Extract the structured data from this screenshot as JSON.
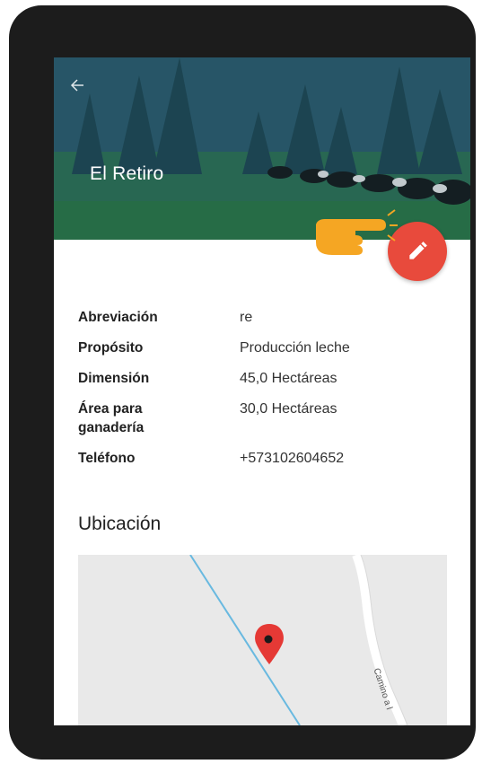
{
  "header": {
    "title": "El Retiro",
    "back_icon": "arrow-left-icon",
    "edit_icon": "pencil-icon"
  },
  "details": [
    {
      "label": "Abreviación",
      "value": "re"
    },
    {
      "label": "Propósito",
      "value": "Producción leche"
    },
    {
      "label": "Dimensión",
      "value": "45,0 Hectáreas"
    },
    {
      "label": "Área para ganadería",
      "value": "30,0 Hectáreas"
    },
    {
      "label": "Teléfono",
      "value": "+573102604652"
    }
  ],
  "location": {
    "title": "Ubicación",
    "road_label": "Camino a l"
  },
  "colors": {
    "fab": "#e84a3c",
    "hand": "#f5a623",
    "map_bg": "#e9e9e9",
    "marker": "#e53935",
    "water_line": "#69b9e0"
  }
}
